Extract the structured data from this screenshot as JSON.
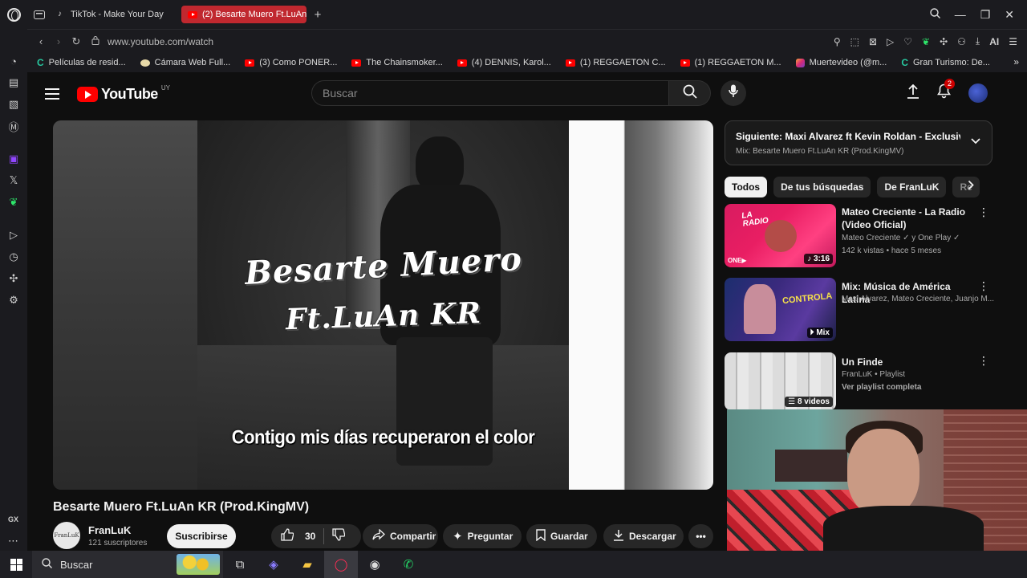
{
  "browser": {
    "tabs": [
      {
        "label": "TikTok - Make Your Day",
        "active": false
      },
      {
        "label": "(2) Besarte Muero Ft.LuAn",
        "active": true
      }
    ],
    "url": "www.youtube.com/watch",
    "ai_label": "AI",
    "sidebar_label": "GX",
    "bookmarks": [
      {
        "label": "Películas de resid...",
        "icon": "c-icon"
      },
      {
        "label": "Cámara Web Full...",
        "icon": "camera-icon"
      },
      {
        "label": "(3) Como PONER...",
        "icon": "youtube-icon"
      },
      {
        "label": "The Chainsmoker...",
        "icon": "youtube-icon"
      },
      {
        "label": "(4) DENNIS, Karol...",
        "icon": "youtube-icon"
      },
      {
        "label": "(1) REGGAETON C...",
        "icon": "youtube-icon"
      },
      {
        "label": "(1) REGGAETON M...",
        "icon": "youtube-icon"
      },
      {
        "label": "Muertevideo (@m...",
        "icon": "instagram-icon"
      },
      {
        "label": "Gran Turismo: De...",
        "icon": "c-icon"
      }
    ]
  },
  "youtube": {
    "logo_text": "YouTube",
    "country": "UY",
    "search_placeholder": "Buscar",
    "notification_count": "2"
  },
  "player": {
    "graffiti_line1": "Besarte Muero",
    "graffiti_line2": "Ft.LuAn KR",
    "subtitle": "Contigo mis días recuperaron el color"
  },
  "video": {
    "title": "Besarte Muero Ft.LuAn KR (Prod.KingMV)",
    "channel_name": "FranLuK",
    "channel_avatar_text": "FranLuK",
    "subscribers": "121 suscriptores",
    "subscribe_label": "Suscribirse",
    "likes": "30",
    "share_label": "Compartir",
    "ask_label": "Preguntar",
    "save_label": "Guardar",
    "download_label": "Descargar"
  },
  "sidebar_right": {
    "next_title": "Siguiente: Maxi Alvarez ft Kevin Roldan - Exclusiva (...",
    "next_sub": "Mix: Besarte Muero Ft.LuAn KR (Prod.KingMV)",
    "chips": [
      "Todos",
      "De tus búsquedas",
      "De FranLuK",
      "Re"
    ],
    "recommendations": [
      {
        "title": "Mateo Creciente - La Radio (Video Oficial)",
        "channel": "Mateo Creciente ✓ y One Play ✓",
        "meta": "142 k vistas • hace 5 meses",
        "badge": "3:16",
        "thumb_text": "LA RADIO",
        "thumb_logo": "ONE▶"
      },
      {
        "title": "Mix: Música de América Latina",
        "channel": "Maxi Alvarez, Mateo Creciente, Juanjo M...",
        "meta": "",
        "badge": "Mix",
        "thumb_text": "CONTROLA"
      },
      {
        "title": "Un Finde",
        "channel": "FranLuK • Playlist",
        "meta": "Ver playlist completa",
        "badge": "8 videos"
      }
    ]
  },
  "taskbar": {
    "search_label": "Buscar"
  }
}
